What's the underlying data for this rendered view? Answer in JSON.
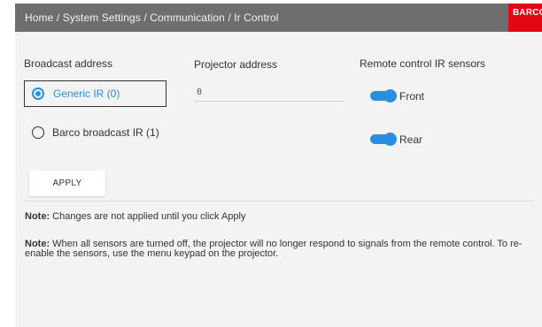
{
  "header": {
    "breadcrumb": "Home / System Settings / Communication / Ir Control",
    "logo_text": "BARCO"
  },
  "broadcast": {
    "heading": "Broadcast address",
    "options": [
      {
        "label": "Generic IR (0)",
        "selected": true
      },
      {
        "label": "Barco broadcast IR (1)",
        "selected": false
      }
    ]
  },
  "projector": {
    "heading": "Projector address",
    "value": "0"
  },
  "sensors": {
    "heading": "Remote control IR sensors",
    "items": [
      {
        "label": "Front",
        "on": true
      },
      {
        "label": "Rear",
        "on": true
      }
    ]
  },
  "apply_label": "APPLY",
  "notes": [
    {
      "prefix": "Note:",
      "text": " Changes are not applied until you click Apply"
    },
    {
      "prefix": "Note:",
      "text": " When all sensors are turned off, the projector will no longer respond to signals from the remote control. To re-enable the sensors, use the menu keypad on the projector."
    }
  ],
  "colors": {
    "header_bg": "#6e6e6e",
    "panel_bg": "#f3f3f3",
    "accent": "#2a8fe0",
    "logo_bg": "#e30613"
  }
}
